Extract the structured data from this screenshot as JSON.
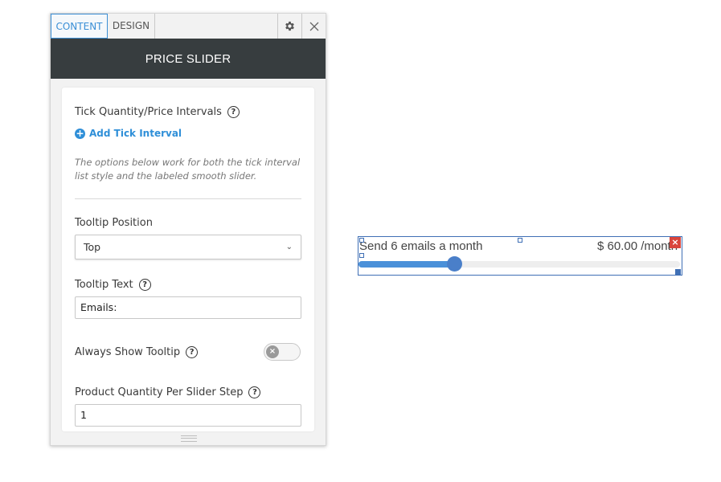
{
  "panel": {
    "tabs": [
      {
        "label": "CONTENT"
      },
      {
        "label": "DESIGN"
      }
    ],
    "icons": {
      "settings": "gear-icon",
      "close": "close-icon"
    },
    "title": "PRICE SLIDER",
    "tick_intervals": {
      "label": "Tick Quantity/Price Intervals",
      "help": "?",
      "add_label": "Add Tick Interval",
      "note": "The options below work for both the tick interval list style and the labeled smooth slider."
    },
    "tooltip_position": {
      "label": "Tooltip Position",
      "help": "?",
      "value": "Top"
    },
    "tooltip_text": {
      "label": "Tooltip Text",
      "help": "?",
      "value": "Emails:"
    },
    "always_show_tooltip": {
      "label": "Always Show Tooltip",
      "help": "?",
      "enabled": false
    },
    "qty_per_step": {
      "label": "Product Quantity Per Slider Step",
      "help": "?",
      "value": "1"
    }
  },
  "widget": {
    "label": "Send 6 emails a month",
    "price": "$ 60.00 /month",
    "slider_fraction": 0.3,
    "accent_color": "#4a90d9"
  },
  "colors": {
    "accent": "#3b8fd6",
    "title_bar": "#373d3f",
    "remove": "#d9453c"
  }
}
